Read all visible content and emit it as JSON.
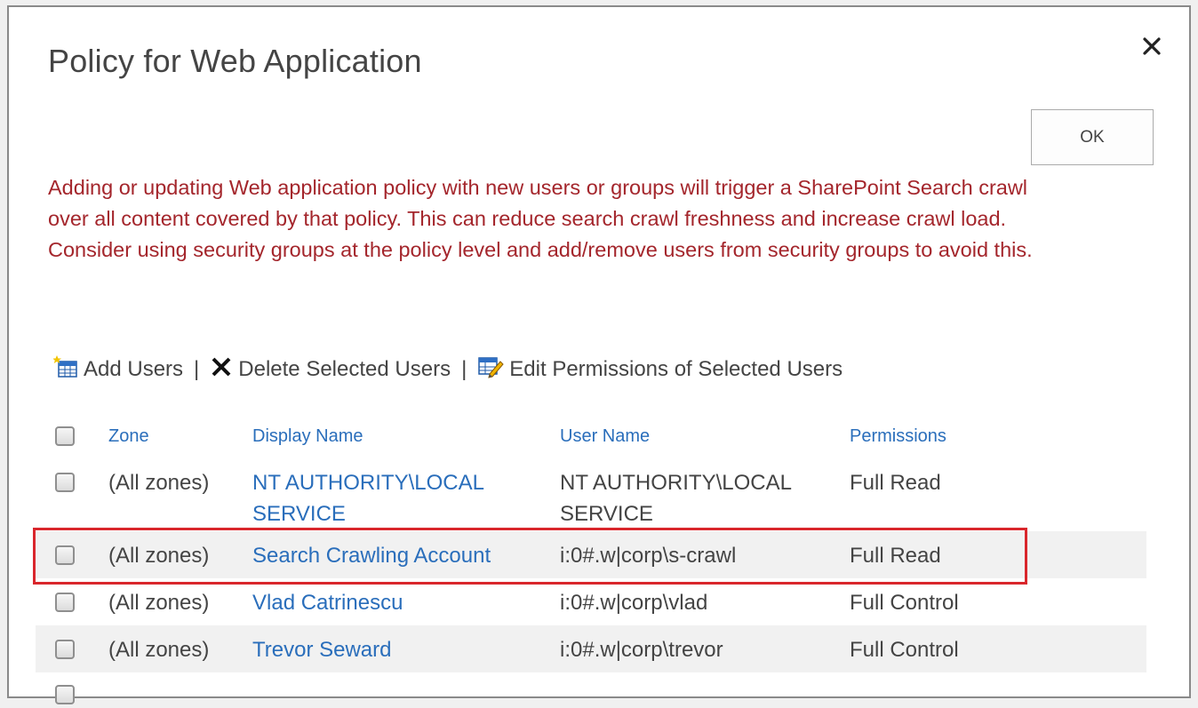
{
  "dialog": {
    "title": "Policy for Web Application",
    "ok_label": "OK",
    "warning": "Adding or updating Web application policy with new users or groups will trigger a SharePoint Search crawl over all content covered by that policy. This can reduce search crawl freshness and increase crawl load. Consider using security groups at the policy level and add/remove users from security groups to avoid this."
  },
  "toolbar": {
    "add_users": "Add Users",
    "delete_users": "Delete Selected Users",
    "edit_permissions": "Edit Permissions of Selected Users",
    "separator": "|"
  },
  "table": {
    "headers": {
      "zone": "Zone",
      "display_name": "Display Name",
      "user_name": "User Name",
      "permissions": "Permissions"
    },
    "rows": [
      {
        "zone": "(All zones)",
        "display_name": "NT AUTHORITY\\LOCAL SERVICE",
        "user_name": "NT AUTHORITY\\LOCAL SERVICE",
        "permissions": "Full Read"
      },
      {
        "zone": "(All zones)",
        "display_name": "Search Crawling Account",
        "user_name": "i:0#.w|corp\\s-crawl",
        "permissions": "Full Read"
      },
      {
        "zone": "(All zones)",
        "display_name": "Vlad Catrinescu",
        "user_name": "i:0#.w|corp\\vlad",
        "permissions": "Full Control"
      },
      {
        "zone": "(All zones)",
        "display_name": "Trevor Seward",
        "user_name": "i:0#.w|corp\\trevor",
        "permissions": "Full Control"
      }
    ]
  },
  "colors": {
    "warning_text": "#a4262c",
    "link": "#2a6ebb",
    "highlight": "#d9262c"
  }
}
